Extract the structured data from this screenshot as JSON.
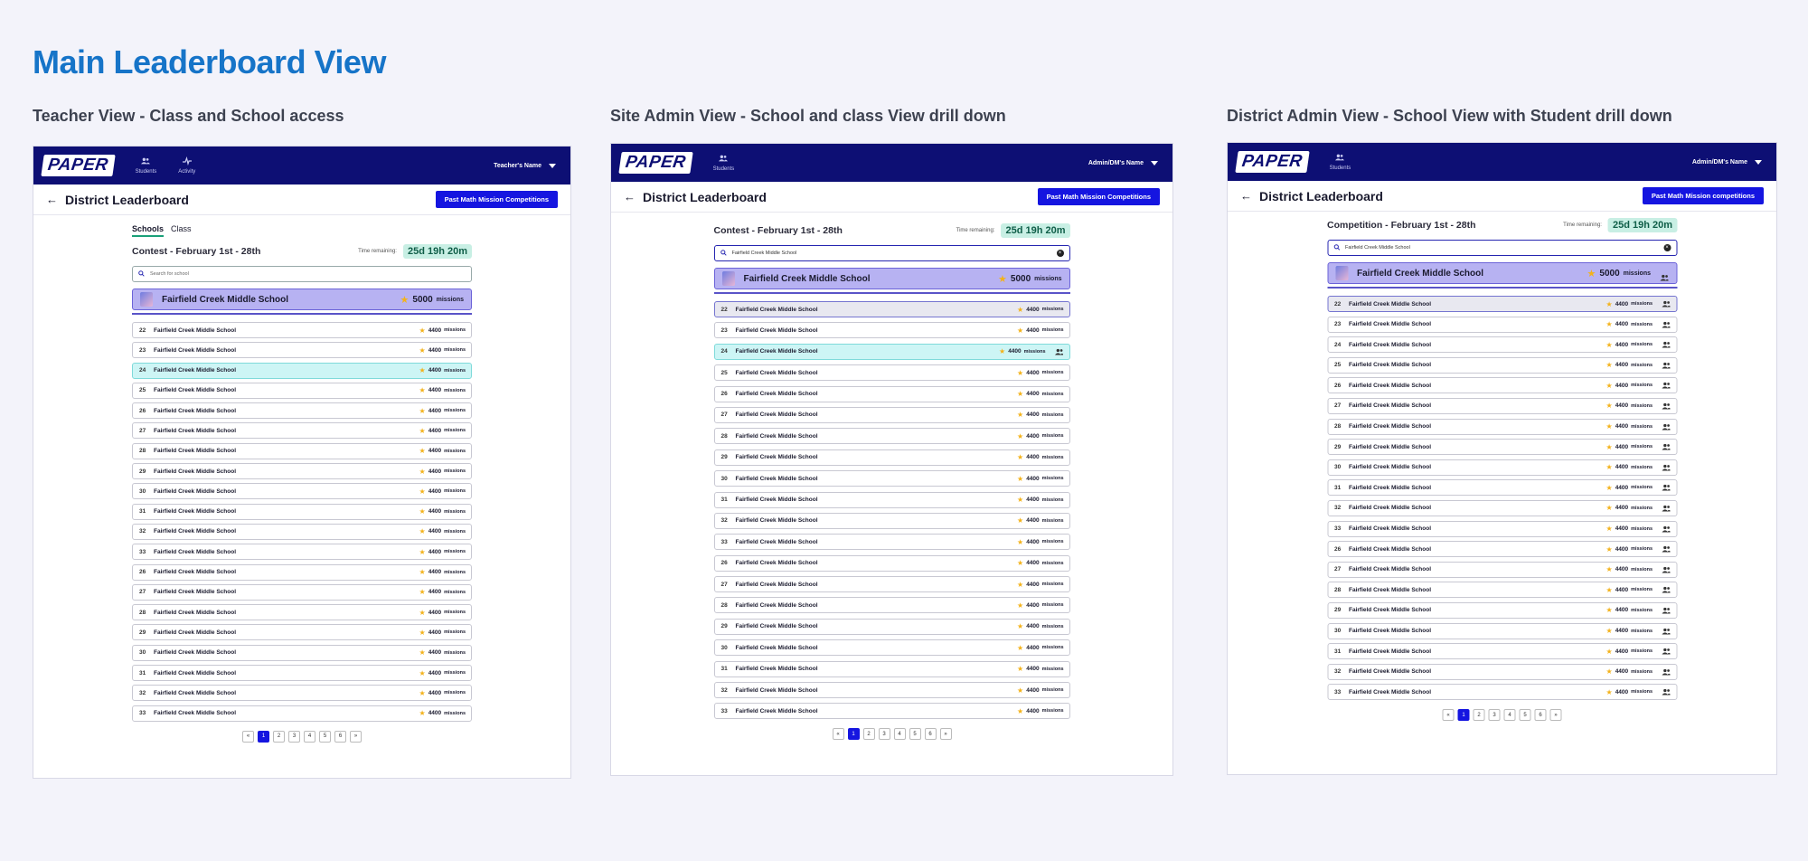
{
  "main_title": "Main Leaderboard View",
  "logo": "PAPER",
  "views": [
    {
      "title": "Teacher View - Class and School  access",
      "user": "Teacher's Name",
      "nav": [
        "Students",
        "Activity"
      ],
      "header_title": "District Leaderboard",
      "past_button": "Past Math Mission Competitions",
      "tabs": [
        "Schools",
        "Class"
      ],
      "contest": "Contest - February 1st - 28th",
      "time_label": "Time remaining:",
      "time_value": "25d 19h 20m",
      "search_text": "Search for school",
      "featured_name": "Fairfield Creek Middle School",
      "featured_score": "5000",
      "featured_unit": "missions",
      "rows": [
        {
          "rank": "22",
          "name": "Fairfield Creek Middle School",
          "score": "4400",
          "unit": "missions"
        },
        {
          "rank": "23",
          "name": "Fairfield Creek Middle School",
          "score": "4400",
          "unit": "missions"
        },
        {
          "rank": "24",
          "name": "Fairfield Creek Middle School",
          "score": "4400",
          "unit": "missions"
        },
        {
          "rank": "25",
          "name": "Fairfield Creek Middle School",
          "score": "4400",
          "unit": "missions"
        },
        {
          "rank": "26",
          "name": "Fairfield Creek Middle School",
          "score": "4400",
          "unit": "missions"
        },
        {
          "rank": "27",
          "name": "Fairfield Creek Middle School",
          "score": "4400",
          "unit": "missions"
        },
        {
          "rank": "28",
          "name": "Fairfield Creek Middle School",
          "score": "4400",
          "unit": "missions"
        },
        {
          "rank": "29",
          "name": "Fairfield Creek Middle School",
          "score": "4400",
          "unit": "missions"
        },
        {
          "rank": "30",
          "name": "Fairfield Creek Middle School",
          "score": "4400",
          "unit": "missions"
        },
        {
          "rank": "31",
          "name": "Fairfield Creek Middle School",
          "score": "4400",
          "unit": "missions"
        },
        {
          "rank": "32",
          "name": "Fairfield Creek Middle School",
          "score": "4400",
          "unit": "missions"
        },
        {
          "rank": "33",
          "name": "Fairfield Creek Middle School",
          "score": "4400",
          "unit": "missions"
        },
        {
          "rank": "26",
          "name": "Fairfield Creek Middle School",
          "score": "4400",
          "unit": "missions"
        },
        {
          "rank": "27",
          "name": "Fairfield Creek Middle School",
          "score": "4400",
          "unit": "missions"
        },
        {
          "rank": "28",
          "name": "Fairfield Creek Middle School",
          "score": "4400",
          "unit": "missions"
        },
        {
          "rank": "29",
          "name": "Fairfield Creek Middle School",
          "score": "4400",
          "unit": "missions"
        },
        {
          "rank": "30",
          "name": "Fairfield Creek Middle School",
          "score": "4400",
          "unit": "missions"
        },
        {
          "rank": "31",
          "name": "Fairfield Creek Middle School",
          "score": "4400",
          "unit": "missions"
        },
        {
          "rank": "32",
          "name": "Fairfield Creek Middle School",
          "score": "4400",
          "unit": "missions"
        },
        {
          "rank": "33",
          "name": "Fairfield Creek Middle School",
          "score": "4400",
          "unit": "missions"
        }
      ],
      "pages": [
        "«",
        "1",
        "2",
        "3",
        "4",
        "5",
        "6",
        "»"
      ]
    },
    {
      "title": "Site Admin View - School  and class View drill down",
      "user": "Admin/DM's Name",
      "nav": [
        "Students"
      ],
      "header_title": "District Leaderboard",
      "past_button": "Past Math Mission Competitions",
      "contest": "Contest - February 1st - 28th",
      "time_label": "Time remaining:",
      "time_value": "25d 19h 20m",
      "search_text": "Fairfield Creek Middle School",
      "featured_name": "Fairfield Creek Middle School",
      "featured_score": "5000",
      "featured_unit": "missions",
      "rows": [
        {
          "rank": "22",
          "name": "Fairfield Creek Middle School",
          "score": "4400",
          "unit": "missions"
        },
        {
          "rank": "23",
          "name": "Fairfield Creek Middle School",
          "score": "4400",
          "unit": "missions"
        },
        {
          "rank": "24",
          "name": "Fairfield Creek Middle School",
          "score": "4400",
          "unit": "missions"
        },
        {
          "rank": "25",
          "name": "Fairfield Creek Middle School",
          "score": "4400",
          "unit": "missions"
        },
        {
          "rank": "26",
          "name": "Fairfield Creek Middle School",
          "score": "4400",
          "unit": "missions"
        },
        {
          "rank": "27",
          "name": "Fairfield Creek Middle School",
          "score": "4400",
          "unit": "missions"
        },
        {
          "rank": "28",
          "name": "Fairfield Creek Middle School",
          "score": "4400",
          "unit": "missions"
        },
        {
          "rank": "29",
          "name": "Fairfield Creek Middle School",
          "score": "4400",
          "unit": "missions"
        },
        {
          "rank": "30",
          "name": "Fairfield Creek Middle School",
          "score": "4400",
          "unit": "missions"
        },
        {
          "rank": "31",
          "name": "Fairfield Creek Middle School",
          "score": "4400",
          "unit": "missions"
        },
        {
          "rank": "32",
          "name": "Fairfield Creek Middle School",
          "score": "4400",
          "unit": "missions"
        },
        {
          "rank": "33",
          "name": "Fairfield Creek Middle School",
          "score": "4400",
          "unit": "missions"
        },
        {
          "rank": "26",
          "name": "Fairfield Creek Middle School",
          "score": "4400",
          "unit": "missions"
        },
        {
          "rank": "27",
          "name": "Fairfield Creek Middle School",
          "score": "4400",
          "unit": "missions"
        },
        {
          "rank": "28",
          "name": "Fairfield Creek Middle School",
          "score": "4400",
          "unit": "missions"
        },
        {
          "rank": "29",
          "name": "Fairfield Creek Middle School",
          "score": "4400",
          "unit": "missions"
        },
        {
          "rank": "30",
          "name": "Fairfield Creek Middle School",
          "score": "4400",
          "unit": "missions"
        },
        {
          "rank": "31",
          "name": "Fairfield Creek Middle School",
          "score": "4400",
          "unit": "missions"
        },
        {
          "rank": "32",
          "name": "Fairfield Creek Middle School",
          "score": "4400",
          "unit": "missions"
        },
        {
          "rank": "33",
          "name": "Fairfield Creek Middle School",
          "score": "4400",
          "unit": "missions"
        }
      ],
      "pages": [
        "«",
        "1",
        "2",
        "3",
        "4",
        "5",
        "6",
        "»"
      ]
    },
    {
      "title": "District Admin View - School View  with Student drill down",
      "user": "Admin/DM's Name",
      "nav": [
        "Students"
      ],
      "header_title": "District Leaderboard",
      "past_button": "Past Math Mission competitions",
      "contest": "Competition - February 1st - 28th",
      "time_label": "Time remaining:",
      "time_value": "25d 19h 20m",
      "search_text": "Fairfield Creek Middle School",
      "featured_name": "Fairfield Creek Middle School",
      "featured_score": "5000",
      "featured_unit": "missions",
      "rows": [
        {
          "rank": "22",
          "name": "Fairfield Creek Middle School",
          "score": "4400",
          "unit": "missions"
        },
        {
          "rank": "23",
          "name": "Fairfield Creek Middle School",
          "score": "4400",
          "unit": "missions"
        },
        {
          "rank": "24",
          "name": "Fairfield Creek Middle School",
          "score": "4400",
          "unit": "missions"
        },
        {
          "rank": "25",
          "name": "Fairfield Creek Middle School",
          "score": "4400",
          "unit": "missions"
        },
        {
          "rank": "26",
          "name": "Fairfield Creek Middle School",
          "score": "4400",
          "unit": "missions"
        },
        {
          "rank": "27",
          "name": "Fairfield Creek Middle School",
          "score": "4400",
          "unit": "missions"
        },
        {
          "rank": "28",
          "name": "Fairfield Creek Middle School",
          "score": "4400",
          "unit": "missions"
        },
        {
          "rank": "29",
          "name": "Fairfield Creek Middle School",
          "score": "4400",
          "unit": "missions"
        },
        {
          "rank": "30",
          "name": "Fairfield Creek Middle School",
          "score": "4400",
          "unit": "missions"
        },
        {
          "rank": "31",
          "name": "Fairfield Creek Middle School",
          "score": "4400",
          "unit": "missions"
        },
        {
          "rank": "32",
          "name": "Fairfield Creek Middle School",
          "score": "4400",
          "unit": "missions"
        },
        {
          "rank": "33",
          "name": "Fairfield Creek Middle School",
          "score": "4400",
          "unit": "missions"
        },
        {
          "rank": "26",
          "name": "Fairfield Creek Middle School",
          "score": "4400",
          "unit": "missions"
        },
        {
          "rank": "27",
          "name": "Fairfield Creek Middle School",
          "score": "4400",
          "unit": "missions"
        },
        {
          "rank": "28",
          "name": "Fairfield Creek Middle School",
          "score": "4400",
          "unit": "missions"
        },
        {
          "rank": "29",
          "name": "Fairfield Creek Middle School",
          "score": "4400",
          "unit": "missions"
        },
        {
          "rank": "30",
          "name": "Fairfield Creek Middle School",
          "score": "4400",
          "unit": "missions"
        },
        {
          "rank": "31",
          "name": "Fairfield Creek Middle School",
          "score": "4400",
          "unit": "missions"
        },
        {
          "rank": "32",
          "name": "Fairfield Creek Middle School",
          "score": "4400",
          "unit": "missions"
        },
        {
          "rank": "33",
          "name": "Fairfield Creek Middle School",
          "score": "4400",
          "unit": "missions"
        }
      ],
      "pages": [
        "«",
        "1",
        "2",
        "3",
        "4",
        "5",
        "6",
        "»"
      ]
    }
  ]
}
